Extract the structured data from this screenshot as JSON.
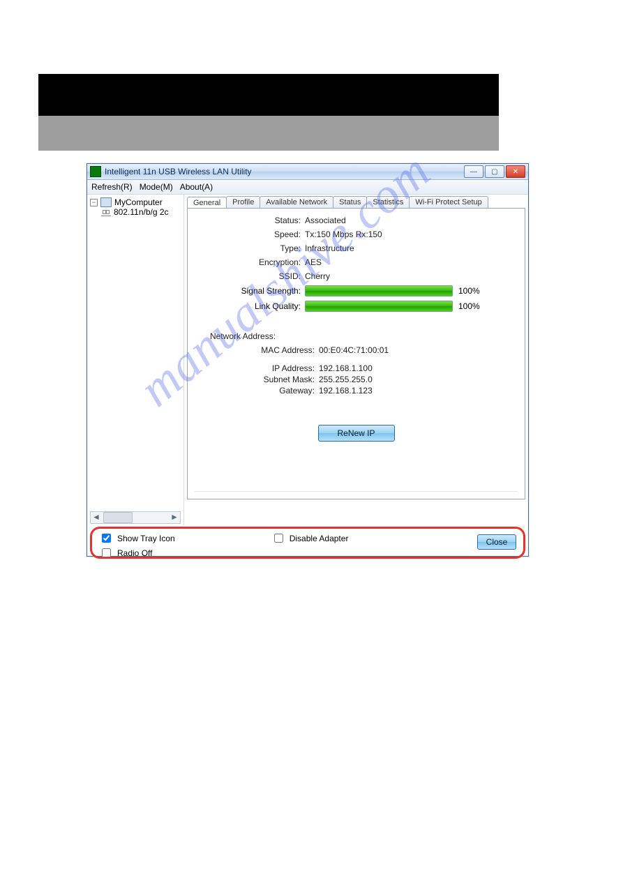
{
  "window": {
    "title": "Intelligent 11n USB Wireless LAN Utility"
  },
  "menu": {
    "refresh": "Refresh(R)",
    "mode": "Mode(M)",
    "about": "About(A)"
  },
  "tree": {
    "root": "MyComputer",
    "child": "802.11n/b/g 2c"
  },
  "tabs": [
    "General",
    "Profile",
    "Available Network",
    "Status",
    "Statistics",
    "Wi-Fi Protect Setup"
  ],
  "general": {
    "labels": {
      "status": "Status:",
      "speed": "Speed:",
      "type": "Type:",
      "encryption": "Encryption:",
      "ssid": "SSID:",
      "signal": "Signal Strength:",
      "link": "Link Quality:"
    },
    "values": {
      "status": "Associated",
      "speed": "Tx:150 Mbps Rx:150",
      "type": "Infrastructure",
      "encryption": "AES",
      "ssid": "Cherry",
      "signal_pct": "100%",
      "link_pct": "100%"
    },
    "network": {
      "group": "Network Address:",
      "labels": {
        "mac": "MAC Address:",
        "ip": "IP Address:",
        "subnet": "Subnet Mask:",
        "gateway": "Gateway:"
      },
      "values": {
        "mac": "00:E0:4C:71:00:01",
        "ip": "192.168.1.100",
        "subnet": "255.255.255.0",
        "gateway": "192.168.1.123"
      }
    },
    "renew_label": "ReNew IP"
  },
  "bottom": {
    "show_tray": "Show Tray Icon",
    "radio_off": "Radio Off",
    "disable_adapter": "Disable Adapter",
    "close": "Close",
    "show_tray_checked": true,
    "radio_off_checked": false,
    "disable_adapter_checked": false
  },
  "watermark": "manualshive.com"
}
